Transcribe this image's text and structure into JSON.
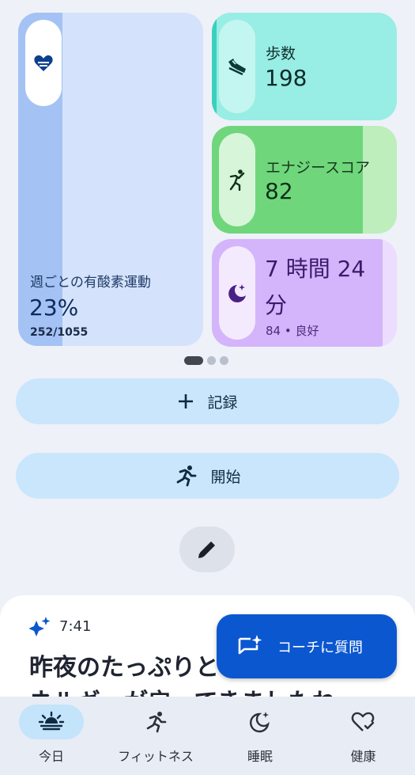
{
  "aerobic": {
    "label": "週ごとの有酸素運動",
    "percent": "23%",
    "ratio": "252/1055",
    "progress": 0.23,
    "icon": "heart-icon"
  },
  "steps": {
    "label": "歩数",
    "value": "198",
    "icon": "shoe-icon"
  },
  "energy": {
    "label": "エナジースコア",
    "value": "82",
    "icon": "running-figure-icon"
  },
  "sleep": {
    "value": "7 時間 24 分",
    "sub": "84 • 良好",
    "icon": "moon-stars-icon"
  },
  "actions": {
    "record_label": "記録",
    "start_label": "開始"
  },
  "insight": {
    "time": "7:41",
    "headline": "昨夜のたっぷりとした睡眠で、エネルギーが戻ってきましたね"
  },
  "coach_button": {
    "label": "コーチに質問"
  },
  "nav": {
    "items": [
      {
        "label": "今日",
        "icon": "sunrise-icon",
        "active": true
      },
      {
        "label": "フィットネス",
        "icon": "running-icon"
      },
      {
        "label": "睡眠",
        "icon": "moon-icon"
      },
      {
        "label": "健康",
        "icon": "heart-check-icon"
      }
    ]
  },
  "colors": {
    "accent": "#0b57d0",
    "aerobic_fill": "#a4c2f4",
    "steps_bg": "#98ede4",
    "energy_fill": "#6fd67c",
    "sleep_fill": "#d4b4fb"
  }
}
